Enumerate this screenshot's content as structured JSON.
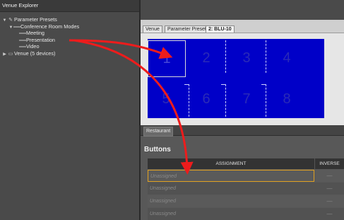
{
  "explorer": {
    "title": "Venue Explorer",
    "tree": [
      {
        "label": "Parameter Presets",
        "twisty": "▼",
        "icon": "✎",
        "icon_name": "pencil-icon"
      },
      {
        "label": "Conference Room Modes",
        "twisty": "▼",
        "icon": "══",
        "icon_name": "preset-group-icon"
      },
      {
        "label": "Meeting",
        "twisty": "",
        "icon": "══",
        "icon_name": "preset-icon"
      },
      {
        "label": "Presentation",
        "twisty": "",
        "icon": "══",
        "icon_name": "preset-icon"
      },
      {
        "label": "Video",
        "twisty": "",
        "icon": "══",
        "icon_name": "preset-icon"
      },
      {
        "label": "Venue (5 devices)",
        "twisty": "▶",
        "icon": "▭",
        "icon_name": "venue-icon"
      }
    ]
  },
  "breadcrumbs": [
    "Venue",
    "Parameter Presets",
    "2: BLU-10"
  ],
  "blu_keys": [
    "1",
    "2",
    "3",
    "4",
    "5",
    "6",
    "7",
    "8"
  ],
  "lower": {
    "tab": "Restaurant",
    "section_title": "Buttons",
    "columns": {
      "assignment": "ASSIGNMENT",
      "inverse": "INVERSE"
    },
    "rows": [
      {
        "assignment": "Unassigned",
        "inverse": "—"
      },
      {
        "assignment": "Unassigned",
        "inverse": "—"
      },
      {
        "assignment": "Unassigned",
        "inverse": "—"
      },
      {
        "assignment": "Unassigned",
        "inverse": "—"
      }
    ]
  },
  "colors": {
    "blu_panel": "#0000c8",
    "arrow": "#ee1c1c",
    "explorer_bg": "#4a4a4a"
  }
}
